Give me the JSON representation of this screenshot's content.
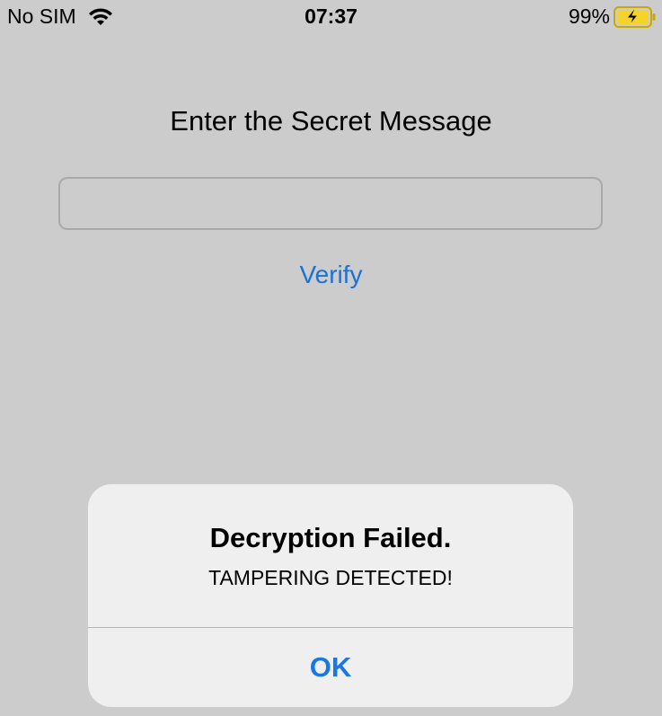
{
  "status_bar": {
    "carrier": "No SIM",
    "time": "07:37",
    "battery_percent": "99%",
    "battery_level": 0.99,
    "charging": true,
    "wifi_icon": "wifi-icon",
    "battery_icon": "battery-charging-icon"
  },
  "main": {
    "prompt": "Enter the Secret Message",
    "message_input": {
      "value": "",
      "placeholder": ""
    },
    "verify_label": "Verify"
  },
  "alert": {
    "title": "Decryption Failed.",
    "message": "TAMPERING DETECTED!",
    "ok_label": "OK"
  },
  "colors": {
    "background": "#cccccc",
    "accent": "#1a72d6",
    "alert_background": "#efefef",
    "battery_fill": "#f5d32a"
  }
}
